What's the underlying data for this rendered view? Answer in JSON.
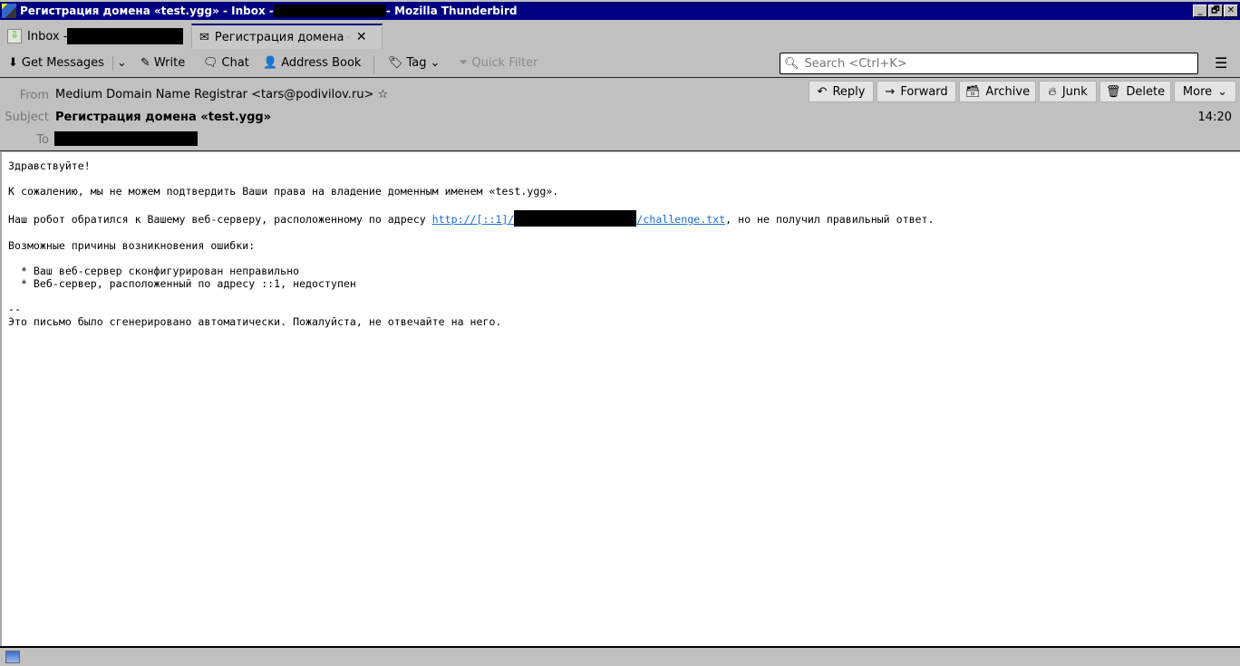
{
  "window": {
    "title_prefix": "Регистрация домена «test.ygg» - Inbox - ",
    "title_suffix": " - Mozilla Thunderbird",
    "controls": [
      "_",
      "🗗",
      "✕"
    ]
  },
  "tabs": [
    {
      "label": "Inbox - "
    },
    {
      "label": "Регистрация домена «"
    }
  ],
  "toolbar": {
    "get_messages": "Get Messages",
    "write": "Write",
    "chat": "Chat",
    "address_book": "Address Book",
    "tag": "Tag",
    "quick_filter": "Quick Filter",
    "search_placeholder": "Search <Ctrl+K>"
  },
  "message": {
    "from_label": "From",
    "from": "Medium Domain Name Registrar <tars@podivilov.ru>",
    "subject_label": "Subject",
    "subject": "Регистрация домена «test.ygg»",
    "to_label": "To",
    "time": "14:20",
    "actions": {
      "reply": "Reply",
      "forward": "Forward",
      "archive": "Archive",
      "junk": "Junk",
      "delete": "Delete",
      "more": "More"
    },
    "body": {
      "l1": "Здравствуйте!",
      "l2": "К сожалению, мы не можем подтвердить Ваши права на владение доменным именем «test.ygg».",
      "l3a": "Наш робот обратился к Вашему веб-серверу, расположенному по адресу ",
      "link_a": "http://[::1]/",
      "link_b": "/challenge.txt",
      "l3b": ", но не получил правильный ответ.",
      "l4": "Возможные причины возникновения ошибки:",
      "l5": "  * Ваш веб-сервер сконфигурирован неправильно",
      "l6": "  * Веб-сервер, расположенный по адресу ::1, недоступен",
      "l7": "--",
      "l8": "Это письмо было сгенерировано автоматически. Пожалуйста, не отвечайте на него."
    }
  },
  "colors": {
    "titlebar": "#000080",
    "link": "#1a6fd8",
    "chrome": "#c0c0c0"
  }
}
